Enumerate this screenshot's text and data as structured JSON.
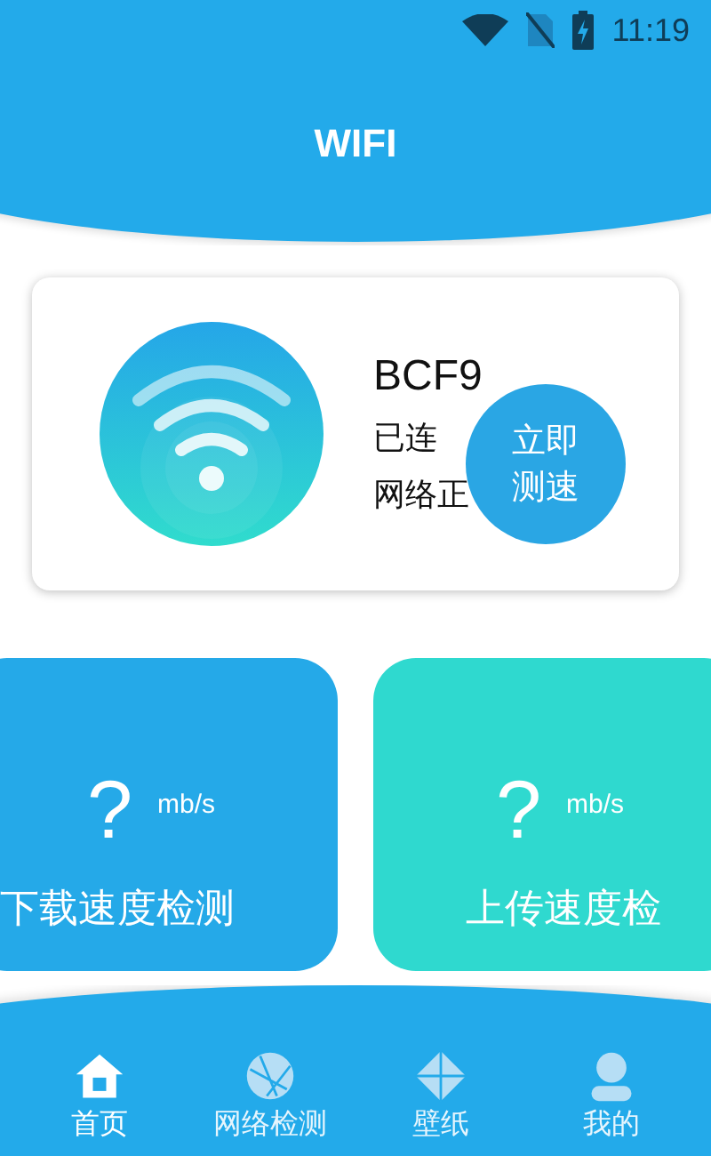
{
  "status_bar": {
    "time": "11:19"
  },
  "header": {
    "title": "WIFI"
  },
  "network": {
    "name": "BCF9",
    "status": "已连",
    "health": "网络正",
    "button": "立即测速"
  },
  "speed_tests": [
    {
      "kind": "download",
      "value": "?",
      "unit": "mb/s",
      "label": "下载速度检测"
    },
    {
      "kind": "upload",
      "value": "?",
      "unit": "mb/s",
      "label": "上传速度检"
    }
  ],
  "nav": [
    {
      "kind": "home",
      "label": "首页",
      "selected": true
    },
    {
      "kind": "network",
      "label": "网络检测",
      "selected": false
    },
    {
      "kind": "wallpaper",
      "label": "壁纸",
      "selected": false
    },
    {
      "kind": "profile",
      "label": "我的",
      "selected": false
    }
  ]
}
